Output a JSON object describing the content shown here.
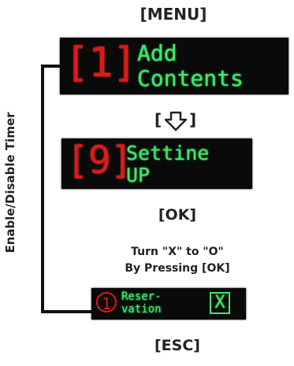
{
  "labels": {
    "menu": "[MENU]",
    "ok": "[OK]",
    "esc": "[ESC]",
    "instruction_line1": "Turn \"X\" to \"O\"",
    "instruction_line2": "By Pressing [OK]",
    "side": "Enable/Disable Timer"
  },
  "arrow": {
    "left_bracket": "[",
    "right_bracket": "]",
    "icon": "down-arrow-icon"
  },
  "screens": {
    "add_contents": {
      "number": "[1]",
      "line1": "Add",
      "line2": "Contents"
    },
    "setting_up": {
      "number": "[9]",
      "line1": "Settine",
      "line2": "UP"
    },
    "reservation": {
      "marker": "1",
      "line1": "Reser-",
      "line2": "vation",
      "checkbox": "X"
    }
  },
  "colors": {
    "lcd_bg": "#0a0a0a",
    "number_red": "#e01818",
    "text_green": "#3fe86a"
  }
}
